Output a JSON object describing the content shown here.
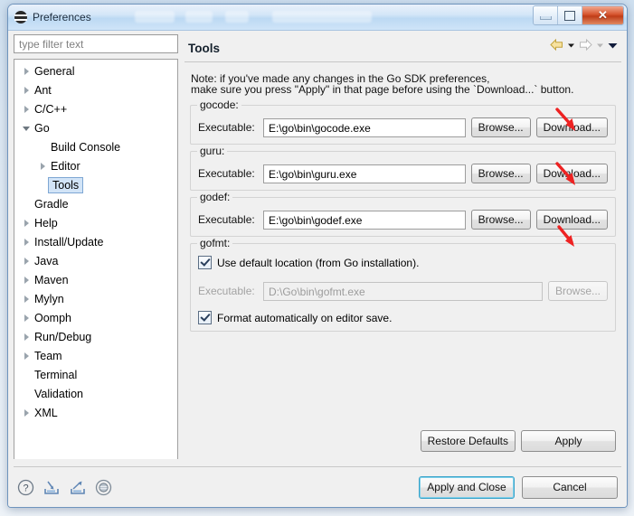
{
  "window": {
    "title": "Preferences",
    "icon": "eclipse-icon",
    "controls": {
      "minimize": "minimize",
      "maximize": "restore",
      "close": "✕"
    }
  },
  "filter": {
    "placeholder": "type filter text",
    "value": ""
  },
  "tree": {
    "items": [
      {
        "label": "General",
        "indent": 0,
        "state": "collapsed"
      },
      {
        "label": "Ant",
        "indent": 0,
        "state": "collapsed"
      },
      {
        "label": "C/C++",
        "indent": 0,
        "state": "collapsed"
      },
      {
        "label": "Go",
        "indent": 0,
        "state": "expanded"
      },
      {
        "label": "Build Console",
        "indent": 1,
        "state": "leaf"
      },
      {
        "label": "Editor",
        "indent": 1,
        "state": "collapsed"
      },
      {
        "label": "Tools",
        "indent": 1,
        "state": "leaf",
        "selected": true
      },
      {
        "label": "Gradle",
        "indent": 0,
        "state": "leaf"
      },
      {
        "label": "Help",
        "indent": 0,
        "state": "collapsed"
      },
      {
        "label": "Install/Update",
        "indent": 0,
        "state": "collapsed"
      },
      {
        "label": "Java",
        "indent": 0,
        "state": "collapsed"
      },
      {
        "label": "Maven",
        "indent": 0,
        "state": "collapsed"
      },
      {
        "label": "Mylyn",
        "indent": 0,
        "state": "collapsed"
      },
      {
        "label": "Oomph",
        "indent": 0,
        "state": "collapsed"
      },
      {
        "label": "Run/Debug",
        "indent": 0,
        "state": "collapsed"
      },
      {
        "label": "Team",
        "indent": 0,
        "state": "collapsed"
      },
      {
        "label": "Terminal",
        "indent": 0,
        "state": "leaf"
      },
      {
        "label": "Validation",
        "indent": 0,
        "state": "leaf"
      },
      {
        "label": "XML",
        "indent": 0,
        "state": "collapsed"
      }
    ]
  },
  "pane": {
    "title": "Tools",
    "nav": {
      "back": "back-arrow",
      "back_menu": "chevron-down",
      "forward": "forward-arrow",
      "forward_menu": "chevron-down",
      "view_menu": "chevron-down"
    },
    "note_line1": "Note: if you've made any changes in the Go SDK preferences,",
    "note_line2": "make sure you press \"Apply\" in that page before using the `Download...` button.",
    "groups": [
      {
        "name": "gocode:",
        "field_label": "Executable:",
        "value": "E:\\go\\bin\\gocode.exe",
        "browse": "Browse...",
        "download": "Download..."
      },
      {
        "name": "guru:",
        "field_label": "Executable:",
        "value": "E:\\go\\bin\\guru.exe",
        "browse": "Browse...",
        "download": "Download..."
      },
      {
        "name": "godef:",
        "field_label": "Executable:",
        "value": "E:\\go\\bin\\godef.exe",
        "browse": "Browse...",
        "download": "Download..."
      }
    ],
    "gofmt": {
      "name": "gofmt:",
      "use_default_label": "Use default location (from Go installation).",
      "use_default_checked": true,
      "field_label": "Executable:",
      "value": "D:\\Go\\bin\\gofmt.exe",
      "field_disabled": true,
      "browse": "Browse...",
      "browse_disabled": true,
      "format_on_save_label": "Format automatically on editor save.",
      "format_on_save_checked": true
    },
    "restore_defaults": "Restore Defaults",
    "apply": "Apply"
  },
  "footer": {
    "icons": [
      "help-icon",
      "import-icon",
      "export-icon",
      "disc-icon"
    ],
    "apply_and_close": "Apply and Close",
    "cancel": "Cancel"
  },
  "annotations": {
    "arrow_color": "#ee2222",
    "arrows": [
      {
        "target": "gocode-download-button"
      },
      {
        "target": "guru-download-button"
      },
      {
        "target": "godef-download-button"
      }
    ]
  }
}
